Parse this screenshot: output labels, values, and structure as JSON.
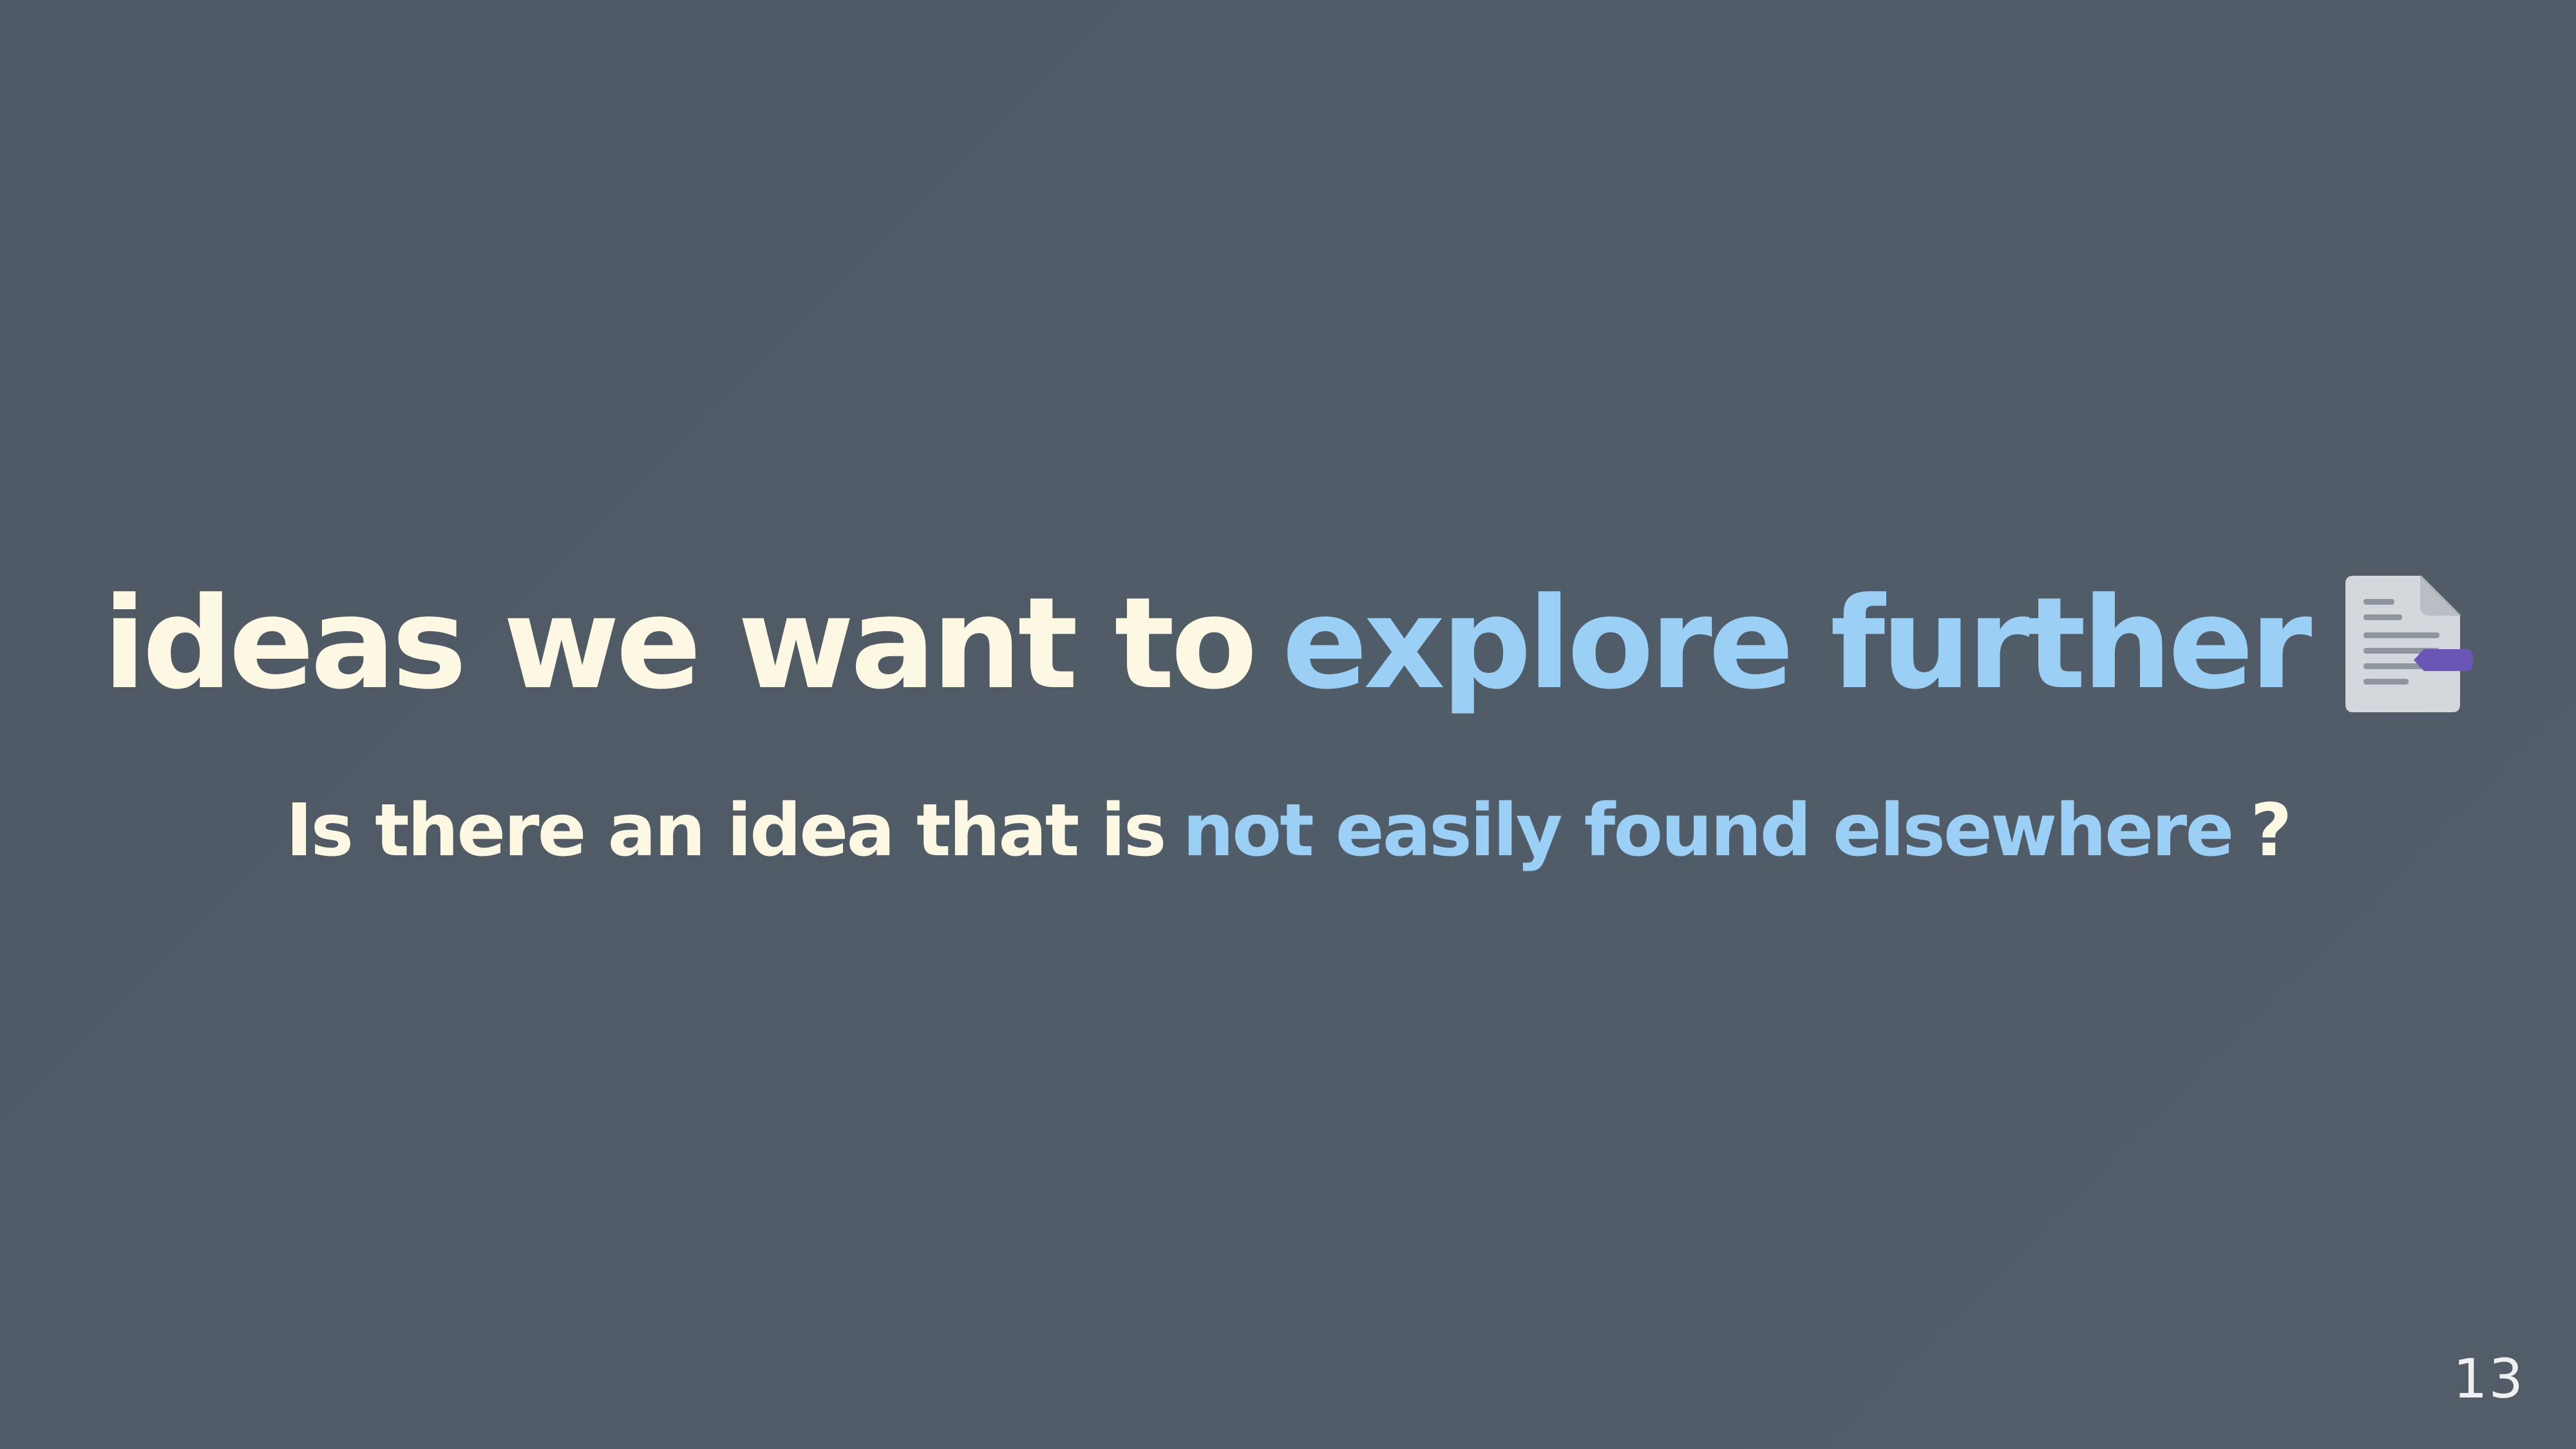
{
  "colors": {
    "background": "#505b66",
    "cream": "#fdf8e4",
    "blue": "#9ccff5",
    "icon_accent": "#6b55b5"
  },
  "slide": {
    "title": {
      "part1": "ideas we want to",
      "part2": "explore further",
      "icon": "document-with-tag-icon"
    },
    "subtitle": {
      "part1": "Is there an idea that is",
      "part2": "not easily found elsewhere",
      "part3": "?"
    },
    "page_number": "13"
  }
}
